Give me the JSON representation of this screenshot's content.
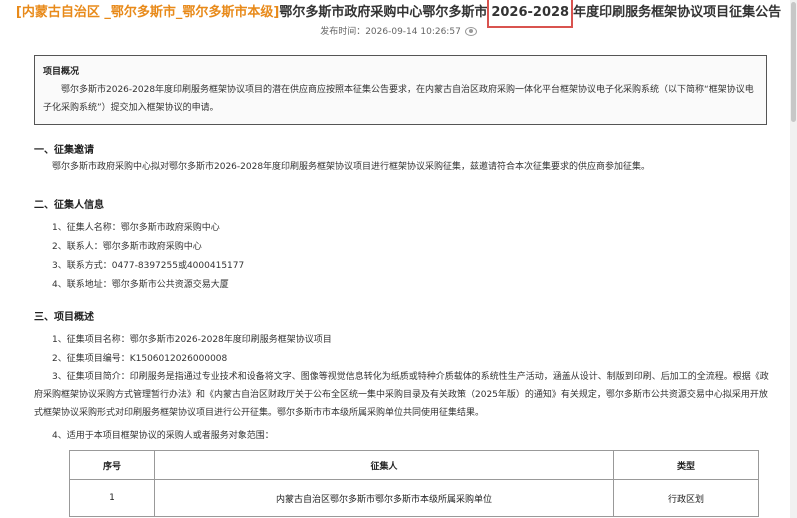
{
  "header": {
    "region": "[内蒙古自治区 _鄂尔多斯市_鄂尔多斯市本级]",
    "title_before": "鄂尔多斯市政府采购中心鄂尔多斯市",
    "title_highlight": "2026-2028",
    "title_after": "年度印刷服务框架协议项目征集公告",
    "pubtime": "发布时间：2026-09-14 10:26:57"
  },
  "overview": {
    "heading": "项目概况",
    "text": "鄂尔多斯市2026-2028年度印刷服务框架协议项目的潜在供应商应按照本征集公告要求，在内蒙古自治区政府采购一体化平台框架协议电子化采购系统（以下简称“框架协议电子化采购系统”）提交加入框架协议的申请。"
  },
  "section1": {
    "title": "一、征集邀请",
    "text": "鄂尔多斯市政府采购中心拟对鄂尔多斯市2026-2028年度印刷服务框架协议项目进行框架协议采购征集，兹邀请符合本次征集要求的供应商参加征集。"
  },
  "section2": {
    "title": "二、征集人信息",
    "items": [
      "1、征集人名称：鄂尔多斯市政府采购中心",
      "2、联系人：鄂尔多斯市政府采购中心",
      "3、联系方式：0477-8397255或4000415177",
      "4、联系地址：鄂尔多斯市公共资源交易大厦"
    ]
  },
  "section3": {
    "title": "三、项目概述",
    "items": [
      "1、征集项目名称：鄂尔多斯市2026-2028年度印刷服务框架协议项目",
      "2、征集项目编号：K1506012026000008"
    ],
    "item3": "3、征集项目简介：印刷服务是指通过专业技术和设备将文字、图像等视觉信息转化为纸质或特种介质载体的系统性生产活动，涵盖从设计、制版到印刷、后加工的全流程。根据《政府采购框架协议采购方式管理暂行办法》和《内蒙古自治区财政厅关于公布全区统一集中采购目录及有关政策（2025年版）的通知》有关规定，鄂尔多斯市公共资源交易中心拟采用开放式框架协议采购形式对印刷服务框架协议项目进行公开征集。鄂尔多斯市市本级所属采购单位共同使用征集结果。",
    "item4": "4、适用于本项目框架协议的采购人或者服务对象范围："
  },
  "table": {
    "headers": [
      "序号",
      "征集人",
      "类型"
    ],
    "rows": [
      [
        "1",
        "内蒙古自治区鄂尔多斯市鄂尔多斯市本级所属采购单位",
        "行政区划"
      ]
    ]
  }
}
